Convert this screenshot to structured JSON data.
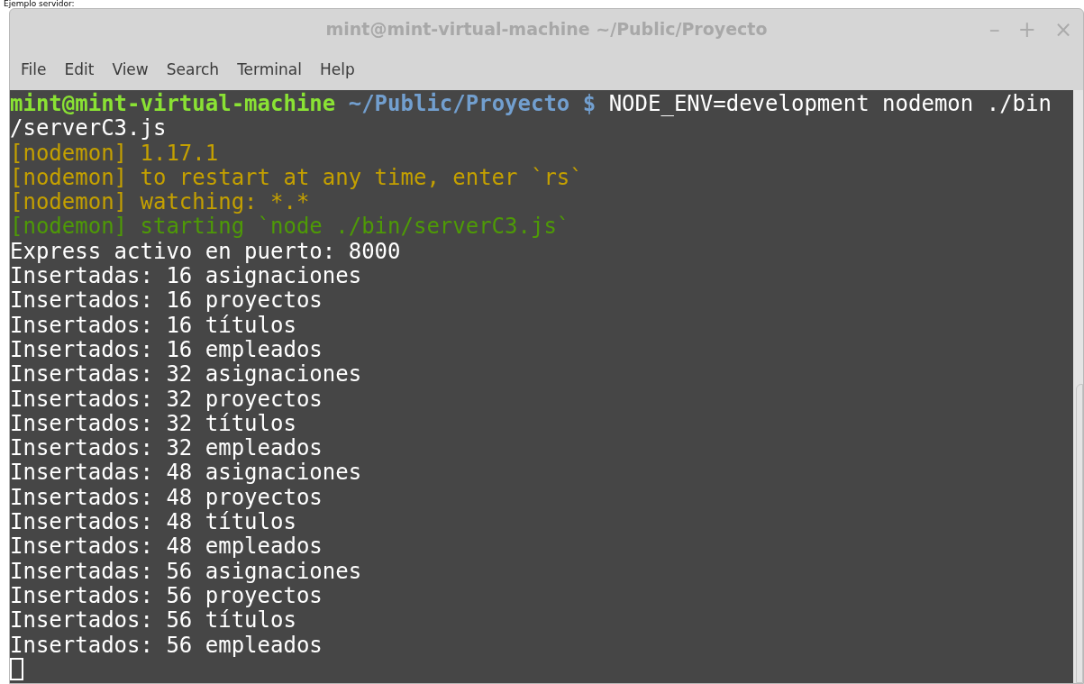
{
  "caption": "Ejemplo servidor:",
  "window": {
    "title": "mint@mint-virtual-machine ~/Public/Proyecto",
    "controls": [
      "–",
      "+",
      "×"
    ]
  },
  "menu": [
    "File",
    "Edit",
    "View",
    "Search",
    "Terminal",
    "Help"
  ],
  "terminal": {
    "lines": [
      [
        {
          "text": "mint@mint-virtual-machine",
          "kind": "user"
        },
        {
          "text": " ~/Public/Proyecto $",
          "kind": "path"
        },
        {
          "text": " NODE_ENV=development nodemon ./bin",
          "kind": "plain"
        }
      ],
      [
        {
          "text": "/serverC3.js",
          "kind": "plain"
        }
      ],
      [
        {
          "text": "[nodemon] 1.17.1",
          "kind": "info"
        }
      ],
      [
        {
          "text": "[nodemon] to restart at any time, enter `rs`",
          "kind": "info"
        }
      ],
      [
        {
          "text": "[nodemon] watching: *.*",
          "kind": "info"
        }
      ],
      [
        {
          "text": "[nodemon] starting `node ./bin/serverC3.js`",
          "kind": "start"
        }
      ],
      [
        {
          "text": "Express activo en puerto: 8000",
          "kind": "plain"
        }
      ],
      [
        {
          "text": "Insertadas: 16 asignaciones",
          "kind": "plain"
        }
      ],
      [
        {
          "text": "Insertados: 16 proyectos",
          "kind": "plain"
        }
      ],
      [
        {
          "text": "Insertados: 16 títulos",
          "kind": "plain"
        }
      ],
      [
        {
          "text": "Insertados: 16 empleados",
          "kind": "plain"
        }
      ],
      [
        {
          "text": "Insertadas: 32 asignaciones",
          "kind": "plain"
        }
      ],
      [
        {
          "text": "Insertados: 32 proyectos",
          "kind": "plain"
        }
      ],
      [
        {
          "text": "Insertados: 32 títulos",
          "kind": "plain"
        }
      ],
      [
        {
          "text": "Insertados: 32 empleados",
          "kind": "plain"
        }
      ],
      [
        {
          "text": "Insertadas: 48 asignaciones",
          "kind": "plain"
        }
      ],
      [
        {
          "text": "Insertados: 48 proyectos",
          "kind": "plain"
        }
      ],
      [
        {
          "text": "Insertados: 48 títulos",
          "kind": "plain"
        }
      ],
      [
        {
          "text": "Insertados: 48 empleados",
          "kind": "plain"
        }
      ],
      [
        {
          "text": "Insertadas: 56 asignaciones",
          "kind": "plain"
        }
      ],
      [
        {
          "text": "Insertados: 56 proyectos",
          "kind": "plain"
        }
      ],
      [
        {
          "text": "Insertados: 56 títulos",
          "kind": "plain"
        }
      ],
      [
        {
          "text": "Insertados: 56 empleados",
          "kind": "plain"
        }
      ]
    ]
  }
}
